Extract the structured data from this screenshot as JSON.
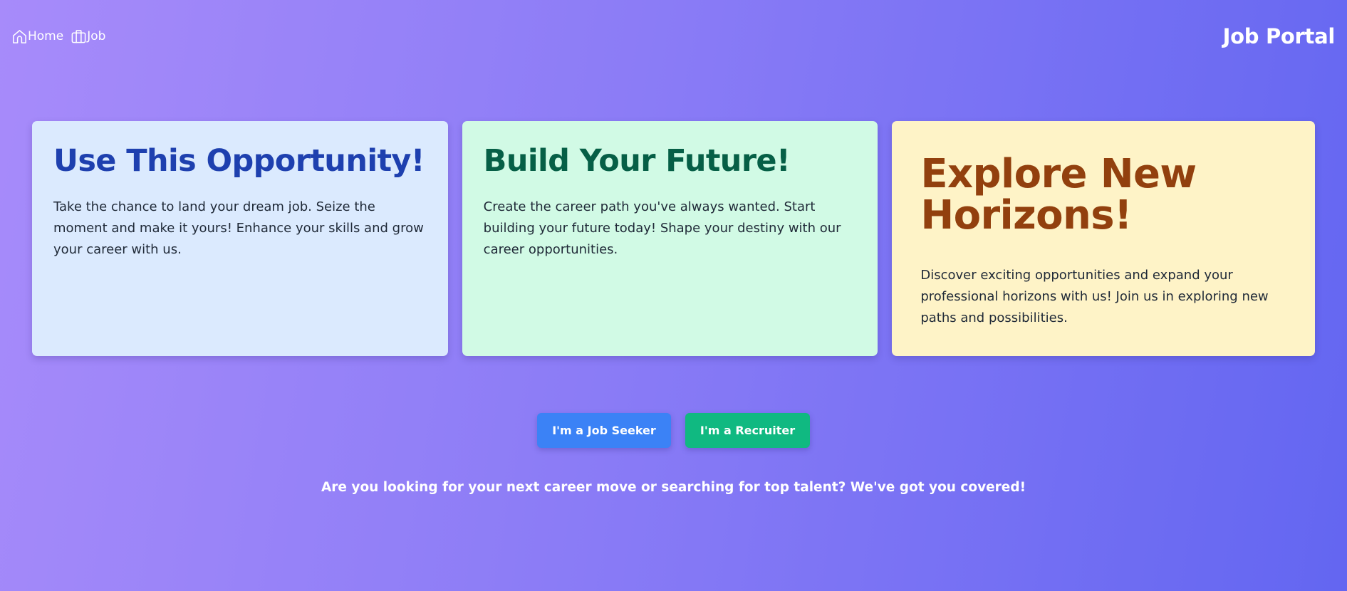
{
  "header": {
    "nav": [
      {
        "label": "Home",
        "icon": "home-icon"
      },
      {
        "label": "Job",
        "icon": "briefcase-icon"
      }
    ],
    "brand": "Job Portal"
  },
  "cards": [
    {
      "title": "Use This Opportunity!",
      "text": "Take the chance to land your dream job. Seize the moment and make it yours! Enhance your skills and grow your career with us.",
      "background": "#dbeafe",
      "title_color": "#1e40af"
    },
    {
      "title": "Build Your Future!",
      "text": "Create the career path you've always wanted. Start building your future today! Shape your destiny with our career opportunities.",
      "background": "#d1fae5",
      "title_color": "#065f46"
    },
    {
      "title": "Explore New Horizons!",
      "text": "Discover exciting opportunities and expand your professional horizons with us! Join us in exploring new paths and possibilities.",
      "background": "#fef3c7",
      "title_color": "#92400e"
    }
  ],
  "cta": {
    "seeker_label": "I'm a Job Seeker",
    "recruiter_label": "I'm a Recruiter",
    "seeker_color": "#3b82f6",
    "recruiter_color": "#10b981"
  },
  "tagline": "Are you looking for your next career move or searching for top talent? We've got you covered!",
  "colors": {
    "gradient_start": "#a78bfa",
    "gradient_end": "#6366f1"
  }
}
